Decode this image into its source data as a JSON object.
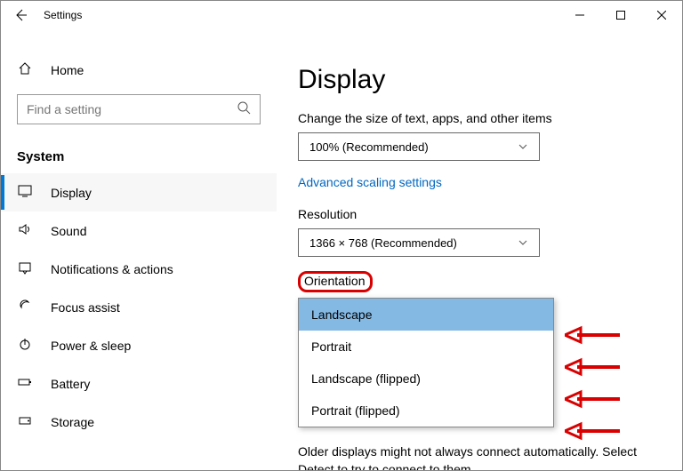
{
  "titlebar": {
    "title": "Settings"
  },
  "sidebar": {
    "home": "Home",
    "search_placeholder": "Find a setting",
    "section": "System",
    "items": [
      {
        "label": "Display"
      },
      {
        "label": "Sound"
      },
      {
        "label": "Notifications & actions"
      },
      {
        "label": "Focus assist"
      },
      {
        "label": "Power & sleep"
      },
      {
        "label": "Battery"
      },
      {
        "label": "Storage"
      }
    ]
  },
  "main": {
    "heading": "Display",
    "scale_label": "Change the size of text, apps, and other items",
    "scale_value": "100% (Recommended)",
    "advanced_link": "Advanced scaling settings",
    "resolution_label": "Resolution",
    "resolution_value": "1366 × 768 (Recommended)",
    "orientation_label": "Orientation",
    "orientation_options": [
      "Landscape",
      "Portrait",
      "Landscape (flipped)",
      "Portrait (flipped)"
    ],
    "note": "Older displays might not always connect automatically. Select Detect to try to connect to them."
  }
}
